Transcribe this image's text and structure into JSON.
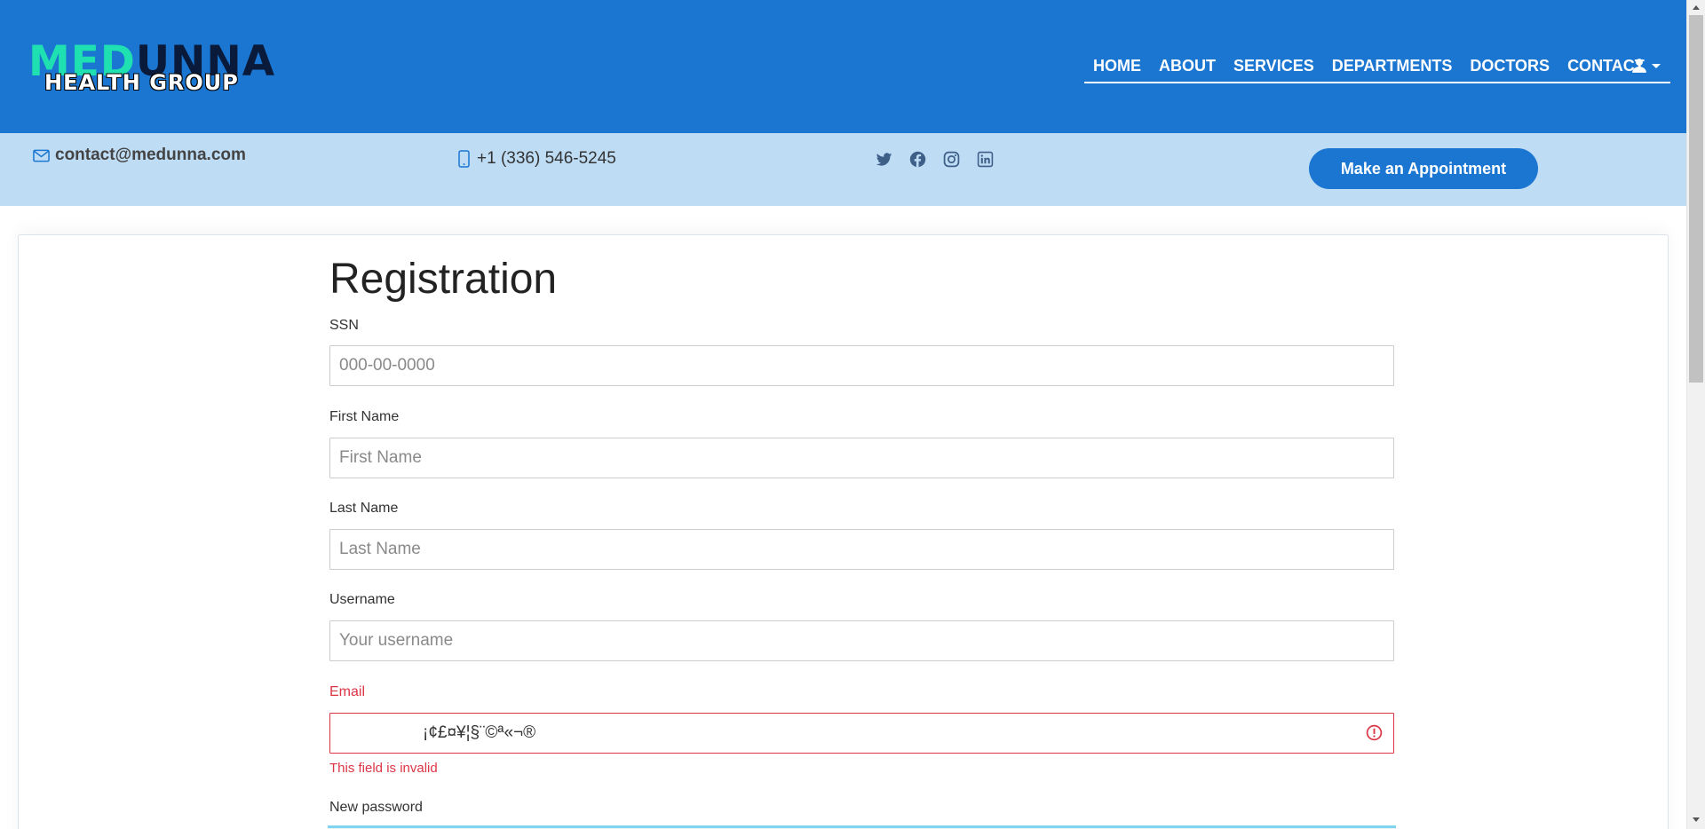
{
  "logo": {
    "part1": "MED",
    "part2": "UNNA",
    "line2": "HEALTH GROUP"
  },
  "nav": {
    "items": [
      {
        "label": "HOME"
      },
      {
        "label": "ABOUT"
      },
      {
        "label": "SERVICES"
      },
      {
        "label": "DEPARTMENTS"
      },
      {
        "label": "DOCTORS"
      },
      {
        "label": "CONTACT"
      }
    ],
    "account_icon": "user-icon"
  },
  "topbar": {
    "email": "contact@medunna.com",
    "phone": "+1 (336) 546-5245",
    "social": [
      "twitter-icon",
      "facebook-icon",
      "instagram-icon",
      "linkedin-icon"
    ],
    "appointment_label": "Make an Appointment"
  },
  "form": {
    "title": "Registration",
    "fields": {
      "ssn": {
        "label": "SSN",
        "placeholder": "000-00-0000"
      },
      "first_name": {
        "label": "First Name",
        "placeholder": "First Name"
      },
      "last_name": {
        "label": "Last Name",
        "placeholder": "Last Name"
      },
      "username": {
        "label": "Username",
        "placeholder": "Your username"
      },
      "email": {
        "label": "Email",
        "value": "¡¢£¤¥¦§¨©ª«¬®",
        "error": "This field is invalid"
      },
      "new_password": {
        "label": "New password"
      }
    }
  },
  "colors": {
    "brand": "#1a76d1",
    "topbar": "#bfdcf5",
    "error": "#dc3545",
    "logo_accent": "#1fe0b0"
  }
}
